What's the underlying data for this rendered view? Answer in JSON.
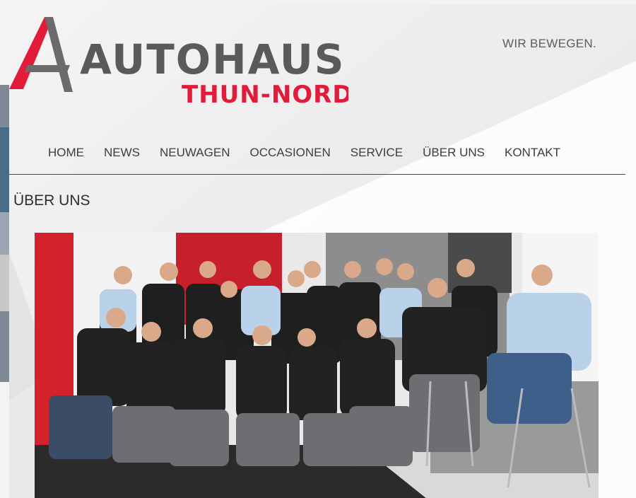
{
  "brand": {
    "name_line1": "AUTOHAUS",
    "name_line2": "THUN-NORD",
    "slogan": "WIR BEWEGEN.",
    "colors": {
      "red": "#e31b3a",
      "grey": "#5a5a5a"
    }
  },
  "nav": {
    "items": [
      {
        "label": "HOME"
      },
      {
        "label": "NEWS"
      },
      {
        "label": "NEUWAGEN"
      },
      {
        "label": "OCCASIONEN"
      },
      {
        "label": "SERVICE"
      },
      {
        "label": "ÜBER UNS"
      },
      {
        "label": "KONTAKT"
      }
    ]
  },
  "page": {
    "title": "ÜBER UNS"
  },
  "photo": {
    "subject": "team-group-photo"
  }
}
